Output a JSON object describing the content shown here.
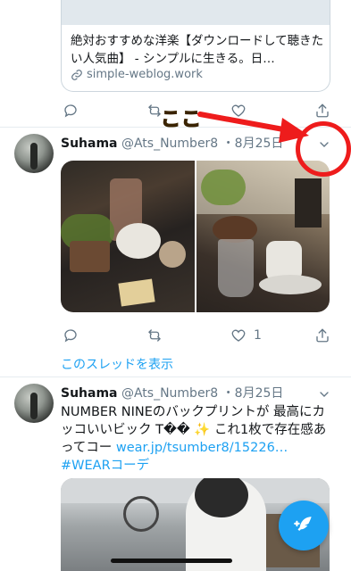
{
  "tweet0": {
    "card_title": "絶対おすすめな洋楽【ダウンロードして聴きたい人気曲】 - シンプルに生きる。日…",
    "card_url": "simple-weblog.work"
  },
  "annotation": {
    "label": "ここ"
  },
  "tweet1": {
    "display_name": "Suhama",
    "handle": "@Ats_Number8",
    "date": "・8月25日",
    "like_count": "1",
    "show_thread": "このスレッドを表示"
  },
  "tweet2": {
    "display_name": "Suhama",
    "handle": "@Ats_Number8",
    "date": "・8月25日",
    "text_plain": "NUMBER NINEのバックプリントが 最高にカッコいいビック T�� ✨ これ1枚で存在感あってコー ",
    "link_text": "wear.jp/tsumber8/15226…",
    "hashtag": " #WEARコーデ"
  },
  "icons": {
    "reply": "reply-icon",
    "retweet": "retweet-icon",
    "like": "heart-icon",
    "share": "share-icon",
    "menu": "chevron-down-icon",
    "compose": "compose-feather-icon",
    "link": "link-icon"
  },
  "colors": {
    "accent": "#1da1f2",
    "annotation_red": "#ee1c1c",
    "annotation_text": "#f6a11a",
    "muted": "#657786"
  }
}
